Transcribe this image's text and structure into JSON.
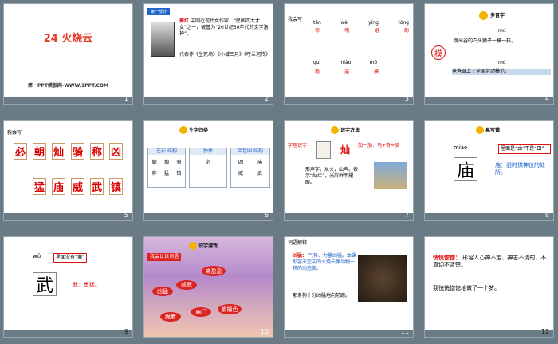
{
  "slides": [
    {
      "num": "1",
      "title": "24 火烧云",
      "footer": "第一PPT模板网-WWW.1PPT.COM"
    },
    {
      "num": "2",
      "tab": "第一部分",
      "author": "萧红",
      "bio": "中国近现代女作家，“民国四大才女”之一，被誉为“20世纪30年代的文学洛神”。",
      "works": "代表作《生死场》《小城三月》《呼兰河传》"
    },
    {
      "num": "3",
      "label": "我会写",
      "pinyin_top": [
        "tān",
        "wèi",
        "yíng",
        "tóng"
      ],
      "chars_top": [
        "惊",
        "哦",
        "姐",
        "韵"
      ],
      "pinyin_bottom": [
        "guì",
        "miào",
        "mó"
      ],
      "chars_bottom": [
        "跪",
        "庙",
        "模"
      ]
    },
    {
      "num": "4",
      "title": "多音字",
      "char": "模",
      "pinyin_top": "mú",
      "sentence_top": "跳出谷的石头狮子一模一样。",
      "pinyin_bottom": "mó",
      "sentence_bottom": "爸爸当上了全国劳动模范。"
    },
    {
      "num": "5",
      "label": "我会写",
      "row1": [
        "必",
        "朝",
        "灿",
        "骑",
        "称",
        "凶"
      ],
      "row2": [
        "猛",
        "庙",
        "威",
        "武",
        "镇"
      ]
    },
    {
      "num": "6",
      "title": "生字归类",
      "groups": [
        {
          "head": "左右 结构",
          "chars": [
            "朝",
            "灿",
            "骑",
            "称",
            "猛",
            "镇"
          ]
        },
        {
          "head": "独体",
          "chars": [
            "必"
          ]
        },
        {
          "head": "半包围 结构",
          "chars": [
            "凶",
            "庙",
            "威",
            "武"
          ]
        }
      ]
    },
    {
      "num": "7",
      "title": "识字方法",
      "hint": "字理识字：",
      "char": "灿",
      "add": "加一加：马+奇=骑",
      "desc": "形声字。从火，山声。表示“灿烂”，光彩鲜明耀眼。"
    },
    {
      "num": "8",
      "title": "易写错",
      "pinyin": "miào",
      "note": "里面是“由”不是“田”",
      "char": "庙",
      "meaning": "庙：旧时供神位的处所。"
    },
    {
      "num": "9",
      "pinyin": "wǔ",
      "note": "里面没有“撇”",
      "char": "武",
      "meaning": "武：勇猛。"
    },
    {
      "num": "10",
      "title": "识字游戏",
      "badge": "我会认读词语",
      "words": [
        "笑盈盈",
        "凶猛",
        "威武",
        "庙门",
        "紫檀色",
        "跪着"
      ]
    },
    {
      "num": "11",
      "label": "词语解释",
      "term": "凶猛：",
      "term_def": "气势、力量凶猛。本课形容天空中的火烧云像动物一样的动态美。",
      "sentence": "那条狗十分凶猛地向前跑。"
    },
    {
      "num": "12",
      "term": "恍恍惚惚：",
      "term_def": "形容人心神不定、神志不清的，不真切不清楚。",
      "sentence": "我恍恍惚惚地做了一个梦。"
    }
  ],
  "colors": {
    "accent_red": "#d11",
    "tab_blue": "#1e64c8",
    "sky_purple": "#b48acb"
  },
  "icons": [
    "lantern-icon",
    "person-photo",
    "horse-photo",
    "dog-photo"
  ]
}
